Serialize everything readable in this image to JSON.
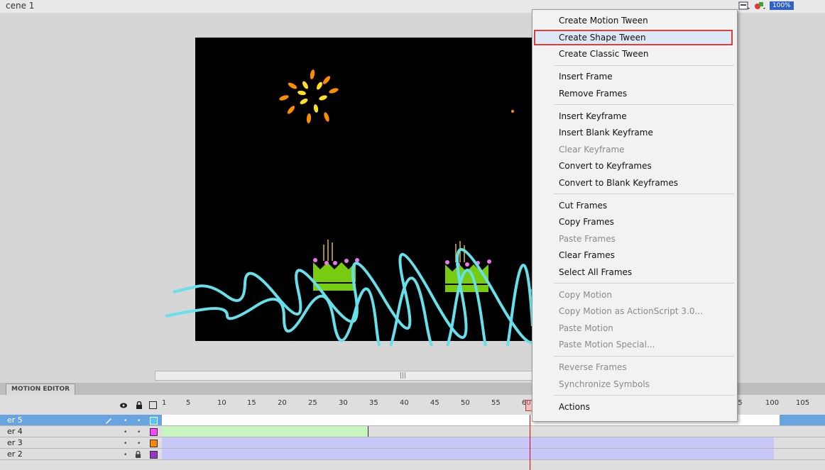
{
  "scene": {
    "label": "cene 1"
  },
  "toolbar": {
    "zoom": "100%",
    "icons": [
      "edit-scene-icon",
      "edit-symbols-icon"
    ]
  },
  "panel": {
    "tab_label": "MOTION EDITOR"
  },
  "timeline": {
    "ruler": [
      "1",
      "5",
      "10",
      "15",
      "20",
      "25",
      "30",
      "35",
      "40",
      "45",
      "50",
      "55",
      "60",
      "95",
      "100",
      "105"
    ],
    "current_frame": 60,
    "layers": [
      {
        "name": "er 5",
        "color": "#59c8f0",
        "selected": true
      },
      {
        "name": "er 4",
        "color": "#ff44ff",
        "selected": false
      },
      {
        "name": "er 3",
        "color": "#ff8800",
        "selected": false
      },
      {
        "name": "er 2",
        "color": "#9933cc",
        "selected": false
      }
    ]
  },
  "context_menu": {
    "items": [
      {
        "label": "Create Motion Tween",
        "enabled": true
      },
      {
        "label": "Create Shape Tween",
        "enabled": true,
        "highlighted": true
      },
      {
        "label": "Create Classic Tween",
        "enabled": true
      },
      {
        "label": "Insert Frame",
        "enabled": true
      },
      {
        "label": "Remove Frames",
        "enabled": true
      },
      {
        "label": "Insert Keyframe",
        "enabled": true
      },
      {
        "label": "Insert Blank Keyframe",
        "enabled": true
      },
      {
        "label": "Clear Keyframe",
        "enabled": false
      },
      {
        "label": "Convert to Keyframes",
        "enabled": true
      },
      {
        "label": "Convert to Blank Keyframes",
        "enabled": true
      },
      {
        "label": "Cut Frames",
        "enabled": true
      },
      {
        "label": "Copy Frames",
        "enabled": true
      },
      {
        "label": "Paste Frames",
        "enabled": false
      },
      {
        "label": "Clear Frames",
        "enabled": true
      },
      {
        "label": "Select All Frames",
        "enabled": true
      },
      {
        "label": "Copy Motion",
        "enabled": false
      },
      {
        "label": "Copy Motion as ActionScript 3.0...",
        "enabled": false
      },
      {
        "label": "Paste Motion",
        "enabled": false
      },
      {
        "label": "Paste Motion Special...",
        "enabled": false
      },
      {
        "label": "Reverse Frames",
        "enabled": false
      },
      {
        "label": "Synchronize Symbols",
        "enabled": false
      },
      {
        "label": "Actions",
        "enabled": true
      }
    ]
  },
  "colors": {
    "accent": "#d8403a",
    "wave": "#66e0ea",
    "tween_classic": "#c8c8f8",
    "tween_shape": "#c8f4c0"
  }
}
